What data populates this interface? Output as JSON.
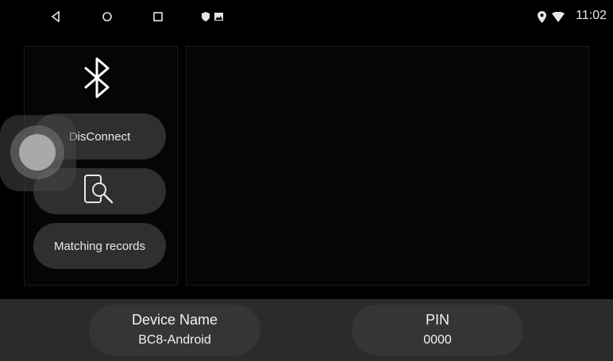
{
  "status_bar": {
    "time": "11:02",
    "nav_icons": [
      "back-icon",
      "home-icon",
      "recents-icon"
    ],
    "notification_icons": [
      "shield-icon",
      "image-icon"
    ],
    "status_icons": [
      "location-icon",
      "wifi-icon"
    ]
  },
  "bluetooth": {
    "icon": "bluetooth-icon",
    "disconnect_label": "DisConnect",
    "search_icon": "device-search-icon",
    "records_label": "Matching records"
  },
  "device_info": {
    "name_label": "Device Name",
    "name_value": "BC8-Android",
    "pin_label": "PIN",
    "pin_value": "0000"
  },
  "colors": {
    "background": "#000000",
    "pill": "#2f2f2f",
    "bottom_bar": "#2b2b2b"
  }
}
